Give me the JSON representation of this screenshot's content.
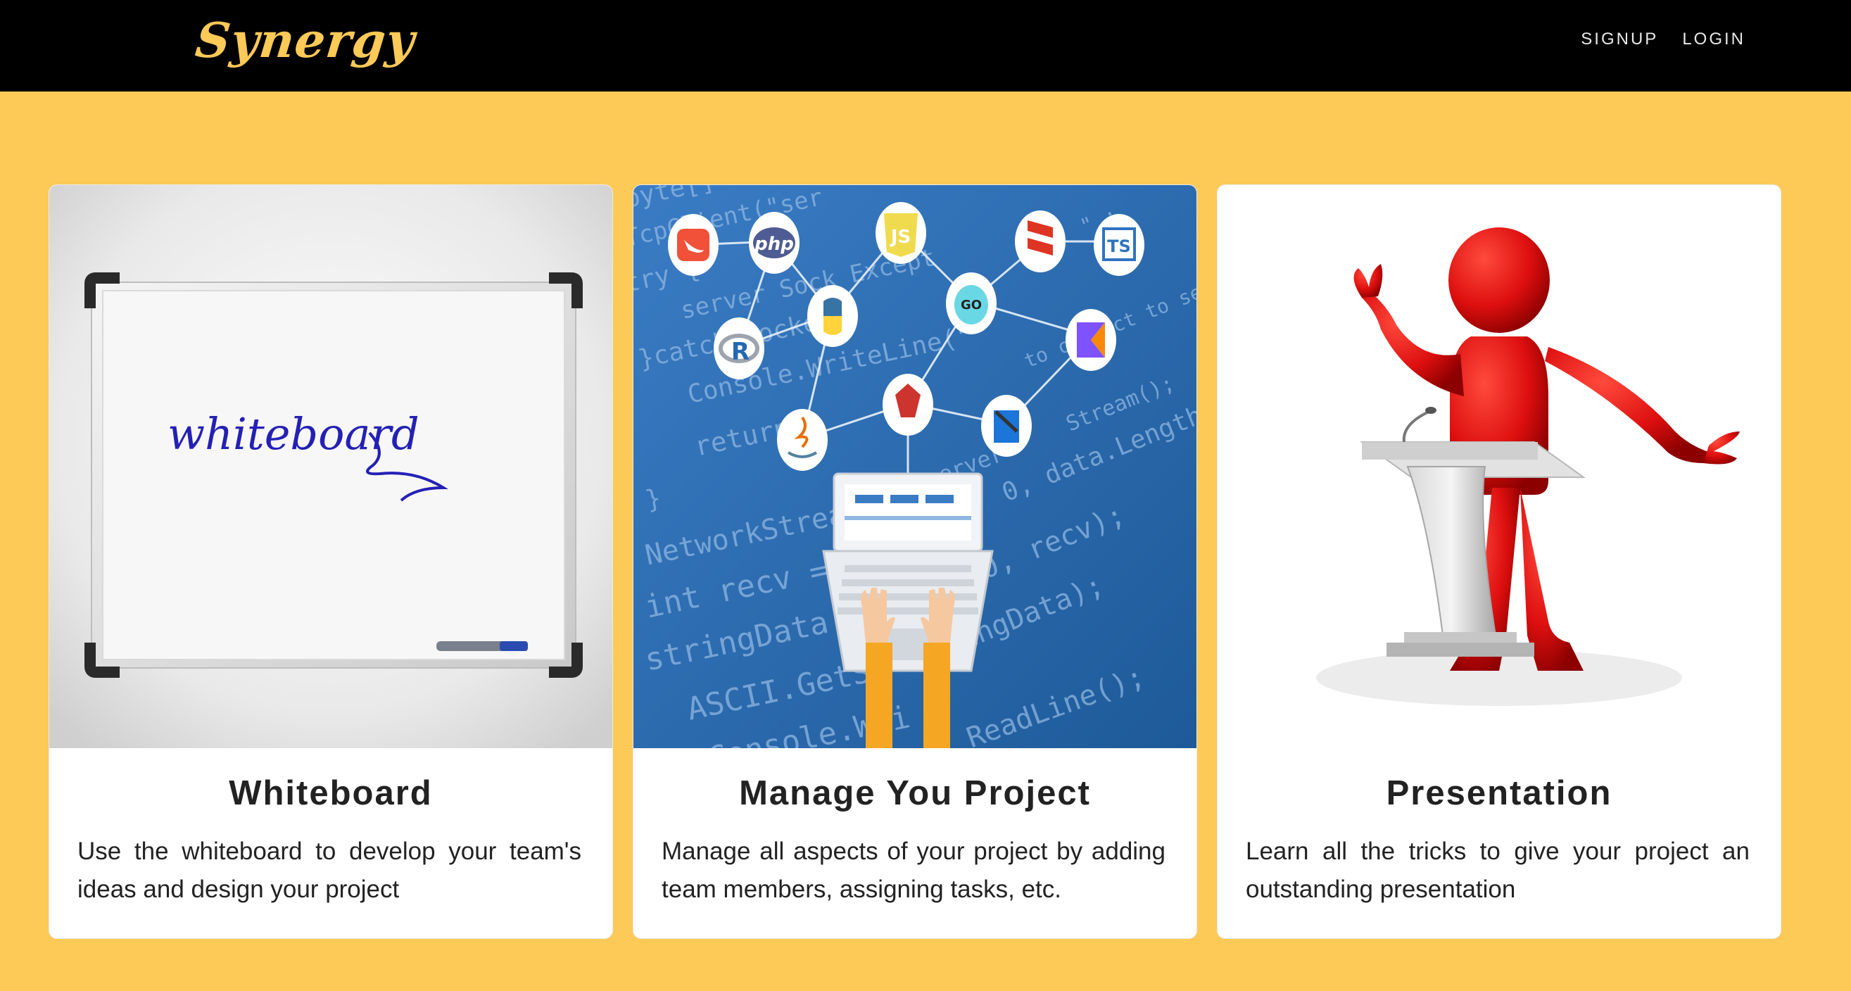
{
  "navbar": {
    "brand": "Synergy",
    "links": [
      {
        "label": "SIGNUP"
      },
      {
        "label": "LOGIN"
      }
    ]
  },
  "cards": [
    {
      "title": "Whiteboard",
      "text": "Use the whiteboard to develop your team's ideas and design your project",
      "image_text": "whiteboard"
    },
    {
      "title": "Manage You Project",
      "text": "Manage all aspects of your project by adding team members, assigning tasks, etc.",
      "image_code_lines": [
        "byte[] client server;",
        "TcpClient(\"ser",
        "try {",
        "server Sock Except",
        "}catch(Socket",
        "Console.WriteLine(\"",
        "return",
        "}",
        "NetworkStream",
        "int recv = n",
        "stringData",
        "ASCII.GetS",
        "Console.Wri",
        "ReadLine();",
        "server",
        "0, data.Length);",
        "0, recv);",
        "ingData);",
        "Stream();",
        "to connect to server",
        "\" ;"
      ],
      "image_logos": [
        "php",
        "JS",
        "TS",
        "R",
        "GO"
      ]
    },
    {
      "title": "Presentation",
      "text": "Learn all the tricks to give your project an outstanding presentation"
    }
  ],
  "colors": {
    "background": "#fdc957",
    "navbar": "#000000",
    "brand": "#fdc957"
  }
}
